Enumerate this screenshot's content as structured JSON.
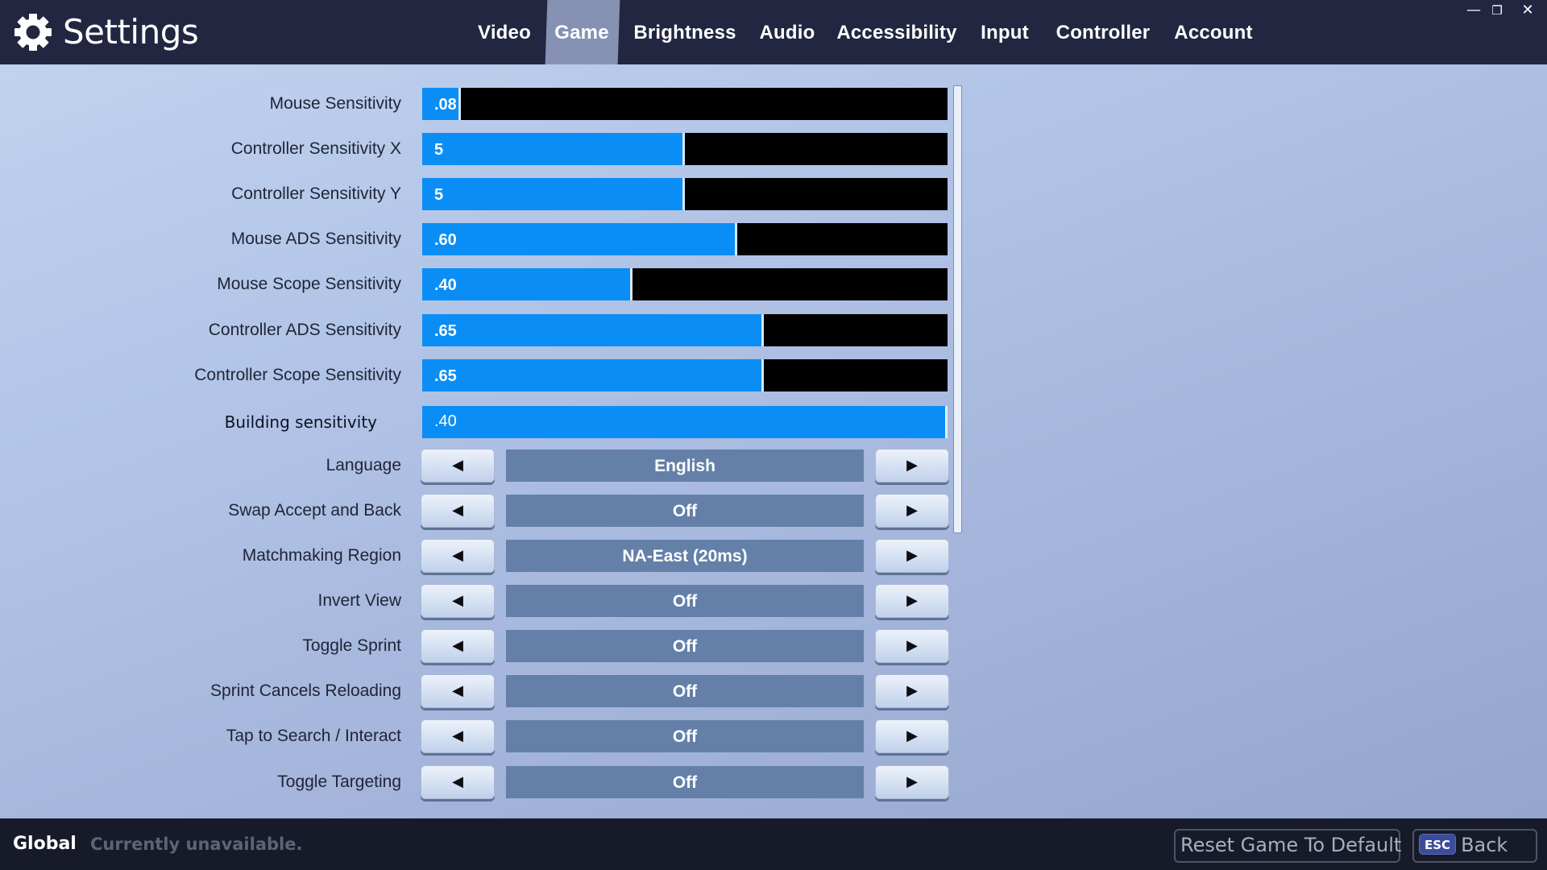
{
  "header": {
    "title": "Settings",
    "title_icon": "gear-icon",
    "tabs": [
      {
        "label": "Video",
        "active": false
      },
      {
        "label": "Game",
        "active": true
      },
      {
        "label": "Brightness",
        "active": false
      },
      {
        "label": "Audio",
        "active": false
      },
      {
        "label": "Accessibility",
        "active": false
      },
      {
        "label": "Input",
        "active": false
      },
      {
        "label": "Controller",
        "active": false
      },
      {
        "label": "Account",
        "active": false
      }
    ],
    "window_controls": {
      "minimize": "—",
      "restore": "❐",
      "close": "✕"
    }
  },
  "sliders": [
    {
      "label": "Mouse Sensitivity",
      "value": ".08",
      "fill_fraction": 0.074
    },
    {
      "label": "Controller Sensitivity X",
      "value": "5",
      "fill_fraction": 0.5
    },
    {
      "label": "Controller Sensitivity Y",
      "value": "5",
      "fill_fraction": 0.5
    },
    {
      "label": "Mouse ADS Sensitivity",
      "value": ".60",
      "fill_fraction": 0.6
    },
    {
      "label": "Mouse Scope Sensitivity",
      "value": ".40",
      "fill_fraction": 0.4
    },
    {
      "label": "Controller ADS Sensitivity",
      "value": ".65",
      "fill_fraction": 0.65
    },
    {
      "label": "Controller Scope Sensitivity",
      "value": ".65",
      "fill_fraction": 0.65
    },
    {
      "label": "Building sensitivity",
      "value": ".40",
      "fill_fraction": 1.0
    }
  ],
  "selectors": [
    {
      "label": "Language",
      "value": "English"
    },
    {
      "label": "Swap Accept and Back",
      "value": "Off"
    },
    {
      "label": "Matchmaking Region",
      "value": "NA-East (20ms)"
    },
    {
      "label": "Invert View",
      "value": "Off"
    },
    {
      "label": "Toggle Sprint",
      "value": "Off"
    },
    {
      "label": "Sprint Cancels Reloading",
      "value": "Off"
    },
    {
      "label": "Tap to Search / Interact",
      "value": "Off"
    },
    {
      "label": "Toggle Targeting",
      "value": "Off"
    }
  ],
  "arrows": {
    "left": "◀",
    "right": "▶"
  },
  "footer": {
    "scope": "Global",
    "status": "Currently unavailable.",
    "reset_label": "Reset Game To Default",
    "back_key": "ESC",
    "back_label": "Back"
  },
  "colors": {
    "header_bg": "#232640",
    "active_tab": "#8592b4",
    "slider_fill": "#0a8ef6",
    "slider_track": "#000000",
    "value_box": "#6480a8",
    "footer_bg": "#171a29"
  }
}
